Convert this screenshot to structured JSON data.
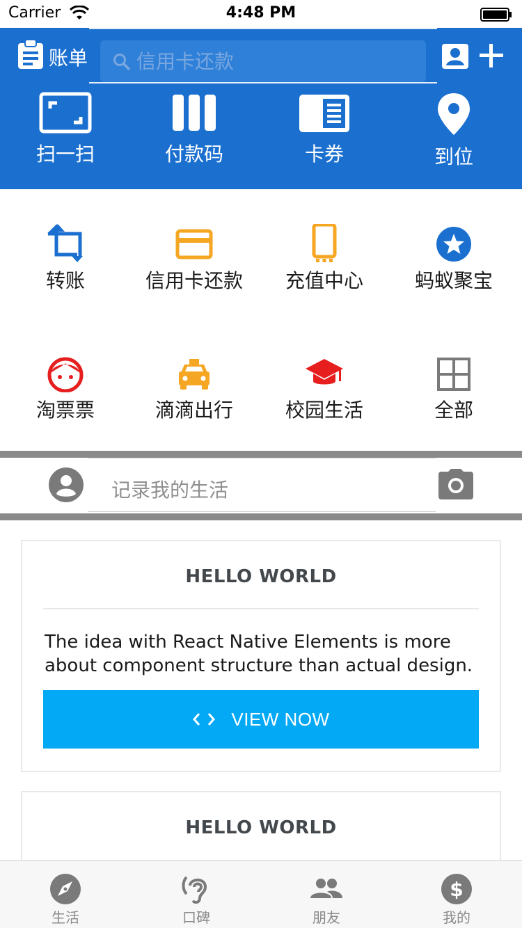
{
  "status_bar": {
    "carrier": "Carrier",
    "time": "4:48 PM"
  },
  "header": {
    "bill_label": "账单",
    "search_placeholder": "信用卡还款",
    "quick_actions": [
      {
        "label": "扫一扫",
        "icon": "scan-icon"
      },
      {
        "label": "付款码",
        "icon": "barcode-icon"
      },
      {
        "label": "卡券",
        "icon": "card-voucher-icon"
      },
      {
        "label": "到位",
        "icon": "location-pin-icon"
      }
    ]
  },
  "services": [
    {
      "label": "转账",
      "icon": "transfer-icon",
      "color": "#1a6fcf"
    },
    {
      "label": "信用卡还款",
      "icon": "credit-card-icon",
      "color": "#f5a623"
    },
    {
      "label": "充值中心",
      "icon": "phone-icon",
      "color": "#f5a623"
    },
    {
      "label": "蚂蚁聚宝",
      "icon": "star-icon",
      "color": "#1a6fcf"
    },
    {
      "label": "淘票票",
      "icon": "face-icon",
      "color": "#e61e1e"
    },
    {
      "label": "滴滴出行",
      "icon": "taxi-icon",
      "color": "#f5a623"
    },
    {
      "label": "校园生活",
      "icon": "graduation-cap-icon",
      "color": "#e61e1e"
    },
    {
      "label": "全部",
      "icon": "grid-icon",
      "color": "#7a7a7a"
    }
  ],
  "record": {
    "placeholder": "记录我的生活"
  },
  "cards": [
    {
      "title": "HELLO WORLD",
      "text": "The idea with React Native Elements is more about component structure than actual design.",
      "button_label": "VIEW NOW"
    },
    {
      "title": "HELLO WORLD"
    }
  ],
  "tabs": [
    {
      "label": "生活",
      "icon": "compass-icon"
    },
    {
      "label": "口碑",
      "icon": "hearing-icon"
    },
    {
      "label": "朋友",
      "icon": "people-icon"
    },
    {
      "label": "我的",
      "icon": "dollar-icon"
    }
  ],
  "colors": {
    "header_blue": "#1a6fcf",
    "button_blue": "#03a9f4",
    "divider_gray": "#8a8a8a"
  }
}
